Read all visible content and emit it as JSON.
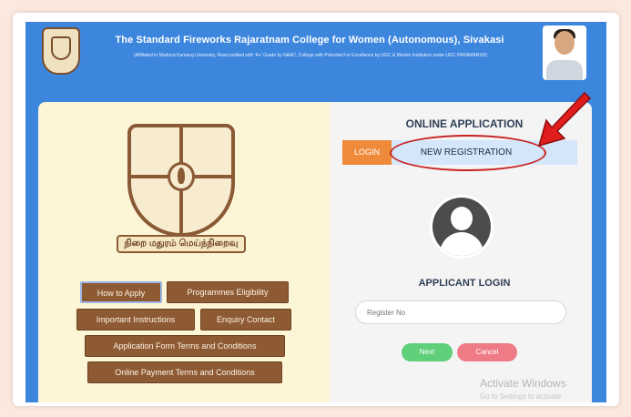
{
  "header": {
    "college_name": "The Standard Fireworks Rajaratnam College for Women (Autonomous), Sivakasi",
    "affiliation": "(Affiliated to Madurai Kamaraj University, Reaccredited with 'A+' Grade by NAAC, College with Potential For Excellence by UGC & Mentor Institution under UGC PARAMARSH)"
  },
  "left_panel": {
    "motto": "நிறை மதுரம் மெய்ந்நிறைவு",
    "buttons": {
      "how_to_apply": "How to Apply",
      "programmes_eligibility": "Programmes Eligibility",
      "important_instructions": "Important Instructions",
      "enquiry_contact": "Enquiry Contact",
      "application_terms": "Application Form Terms and Conditions",
      "payment_terms": "Online Payment Terms and Conditions"
    }
  },
  "right_panel": {
    "title": "ONLINE APPLICATION",
    "tabs": {
      "login": "LOGIN",
      "new_registration": "NEW REGISTRATION"
    },
    "login_title": "APPLICANT LOGIN",
    "register_placeholder": "Register No",
    "next_label": "Next",
    "cancel_label": "Cancel"
  },
  "watermark": {
    "title": "Activate Windows",
    "subtitle": "Go to Settings to activate"
  },
  "colors": {
    "banner": "#3d86de",
    "brown_button": "#8d5a34",
    "login_tab": "#ef8a3a",
    "highlight": "#c92222",
    "next_button": "#5fcf7a",
    "cancel_button": "#ee7b86"
  }
}
